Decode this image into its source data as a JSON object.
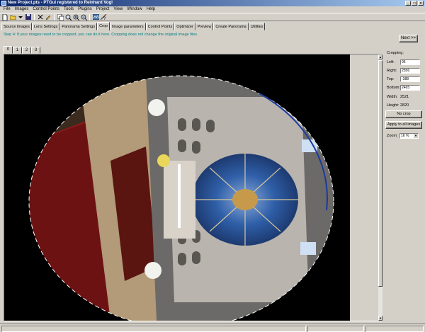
{
  "window": {
    "title": "New Project.pts - PTGui registered to Reinhard Vogl",
    "buttons": [
      "_",
      "□",
      "×"
    ]
  },
  "menu": [
    "File",
    "Images",
    "Control Points",
    "Tools",
    "Plugins",
    "Project",
    "View",
    "Window",
    "Help"
  ],
  "toolbar": {
    "icons": [
      "new-icon",
      "open-icon",
      "dropdown-icon",
      "save-icon",
      "cut-icon",
      "pencil-icon",
      "copy-icon",
      "zoom-icon",
      "zoom-in-icon",
      "zoom-out-icon",
      "panorama-editor-icon",
      "help-icon"
    ]
  },
  "tabs": [
    "Source Images",
    "Lens Settings",
    "Panorama Settings",
    "Crop",
    "Image parameters",
    "Control Points",
    "Optimizer",
    "Preview",
    "Create Panorama",
    "Utilities"
  ],
  "active_tab": "Crop",
  "hint": "Step 4: If your images need to be cropped, you can do it here. Cropping does not change the original image files.",
  "next_label": "Next >>",
  "image_tabs": [
    "0",
    "1",
    "2",
    "3"
  ],
  "cropping": {
    "heading": "Cropping:",
    "left_label": "Left:",
    "left_value": "95",
    "right_label": "Right:",
    "right_value": "2556",
    "top_label": "Top:",
    "top_value": "-388",
    "bottom_label": "Bottom:",
    "bottom_value": "2465",
    "width_label": "Width:",
    "width_value": "2521",
    "height_label": "Height:",
    "height_value": "2820",
    "no_crop_label": "No crop",
    "apply_all_label": "Apply to all images",
    "zoom_label": "Zoom:",
    "zoom_value": "16 %"
  }
}
